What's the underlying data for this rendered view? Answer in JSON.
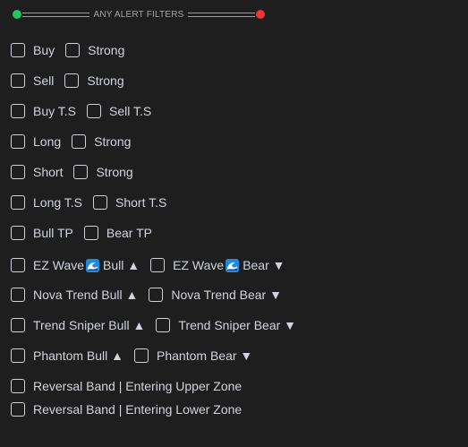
{
  "header": {
    "title": "ANY ALERT FILTERS",
    "left_dot_color": "#22c55e",
    "right_dot_color": "#ef3535"
  },
  "rows": [
    {
      "options": [
        {
          "label": "Buy",
          "checked": false
        },
        {
          "label": "Strong",
          "checked": false
        }
      ]
    },
    {
      "options": [
        {
          "label": "Sell",
          "checked": false
        },
        {
          "label": "Strong",
          "checked": false
        }
      ]
    },
    {
      "options": [
        {
          "label": "Buy T.S",
          "checked": false
        },
        {
          "label": "Sell T.S",
          "checked": false
        }
      ]
    },
    {
      "options": [
        {
          "label": "Long",
          "checked": false
        },
        {
          "label": "Strong",
          "checked": false
        }
      ]
    },
    {
      "options": [
        {
          "label": "Short",
          "checked": false
        },
        {
          "label": "Strong",
          "checked": false
        }
      ]
    },
    {
      "options": [
        {
          "label": "Long T.S",
          "checked": false
        },
        {
          "label": "Short T.S",
          "checked": false
        }
      ]
    },
    {
      "options": [
        {
          "label": "Bull TP",
          "checked": false
        },
        {
          "label": "Bear TP",
          "checked": false
        }
      ]
    },
    {
      "options": [
        {
          "label_pre": "EZ Wave",
          "icon": "wave-icon",
          "label_post": "Bull ▲",
          "checked": false
        },
        {
          "label_pre": "EZ Wave",
          "icon": "wave-icon",
          "label_post": "Bear ▼",
          "checked": false
        }
      ]
    },
    {
      "options": [
        {
          "label": "Nova Trend Bull ▲",
          "checked": false
        },
        {
          "label": "Nova Trend Bear ▼",
          "checked": false
        }
      ]
    },
    {
      "options": [
        {
          "label": "Trend Sniper Bull ▲",
          "checked": false
        },
        {
          "label": "Trend Sniper Bear ▼",
          "checked": false
        }
      ]
    },
    {
      "options": [
        {
          "label": "Phantom Bull ▲",
          "checked": false
        },
        {
          "label": "Phantom Bear ▼",
          "checked": false
        }
      ]
    },
    {
      "options": [
        {
          "label": "Reversal Band | Entering Upper Zone",
          "checked": false
        }
      ]
    },
    {
      "options": [
        {
          "label": "Reversal Band | Entering Lower Zone",
          "checked": false
        }
      ]
    }
  ]
}
